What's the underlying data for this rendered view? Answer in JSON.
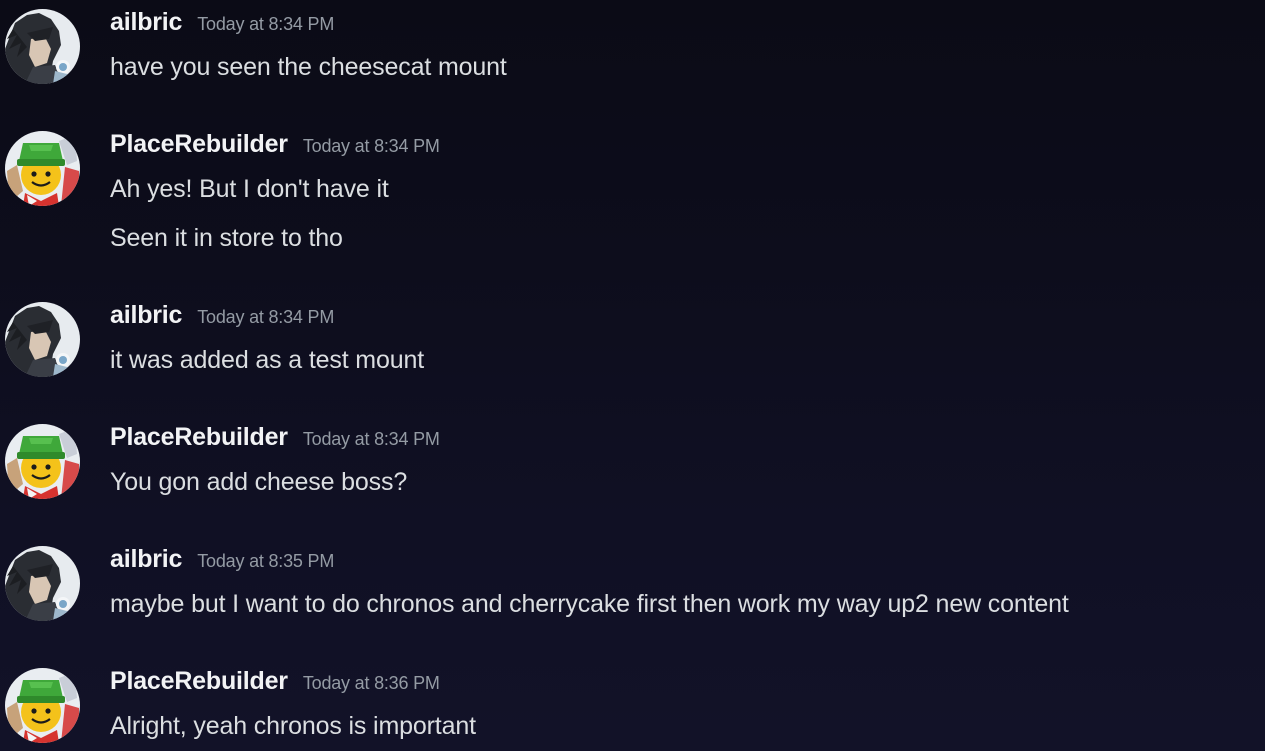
{
  "messages": [
    {
      "author": "ailbric",
      "timestamp": "Today at 8:34 PM",
      "avatar": "ailbric-avatar",
      "lines": [
        "have you seen the cheesecat mount"
      ]
    },
    {
      "author": "PlaceRebuilder",
      "timestamp": "Today at 8:34 PM",
      "avatar": "placerebuilder-avatar",
      "lines": [
        "Ah yes! But I don't have it",
        "Seen it in store to tho"
      ]
    },
    {
      "author": "ailbric",
      "timestamp": "Today at 8:34 PM",
      "avatar": "ailbric-avatar",
      "lines": [
        "it was added as a test mount"
      ]
    },
    {
      "author": "PlaceRebuilder",
      "timestamp": "Today at 8:34 PM",
      "avatar": "placerebuilder-avatar",
      "lines": [
        "You gon add cheese boss?"
      ]
    },
    {
      "author": "ailbric",
      "timestamp": "Today at 8:35 PM",
      "avatar": "ailbric-avatar",
      "lines": [
        "maybe but I want to do chronos and cherrycake first then work my way up2 new content"
      ]
    },
    {
      "author": "PlaceRebuilder",
      "timestamp": "Today at 8:36 PM",
      "avatar": "placerebuilder-avatar",
      "lines": [
        "Alright, yeah chronos is important"
      ]
    }
  ],
  "colors": {
    "background": "#0d0d1c",
    "username": "#f2f3f5",
    "timestamp": "#949ba4",
    "message_text": "#dbdee1"
  }
}
